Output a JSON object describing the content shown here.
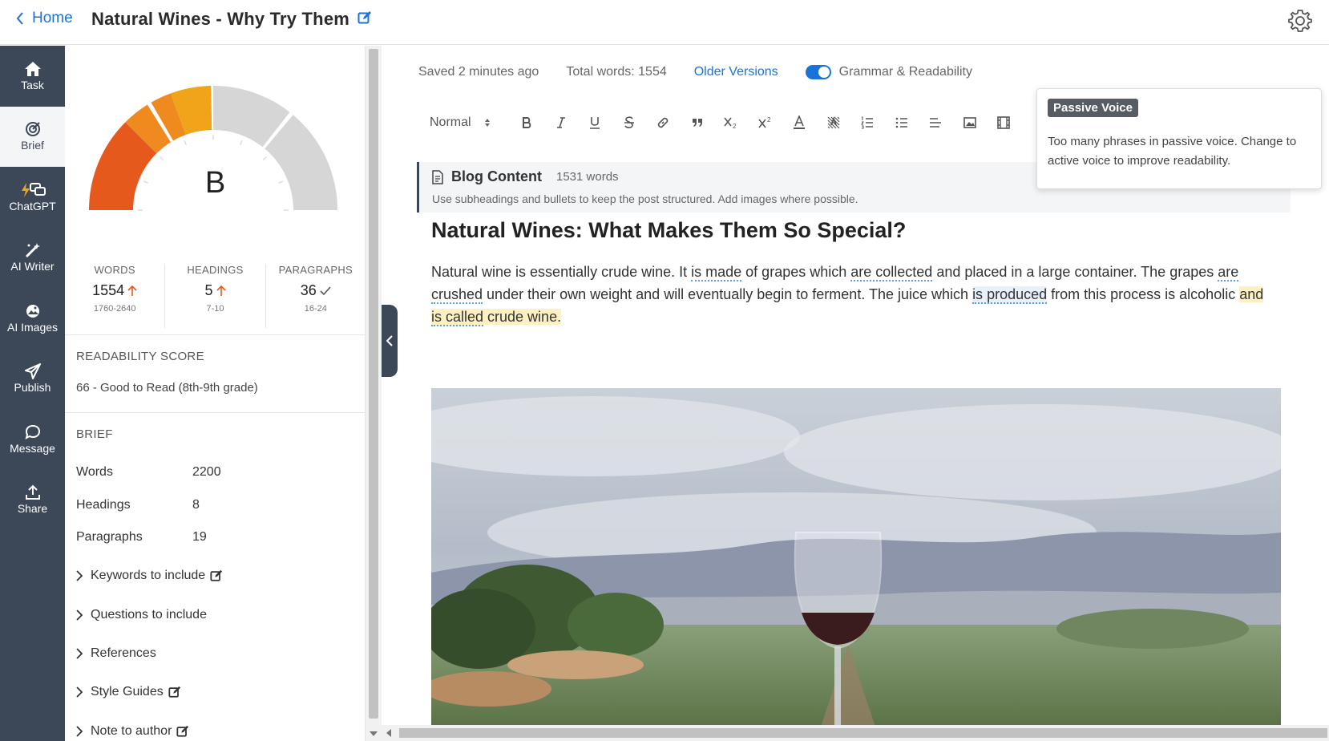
{
  "header": {
    "home_label": "Home",
    "title": "Natural Wines - Why Try Them"
  },
  "rail": {
    "items": [
      {
        "label": "Task",
        "icon": "home-icon"
      },
      {
        "label": "Brief",
        "icon": "target-icon"
      },
      {
        "label": "ChatGPT",
        "icon": "chat-bolt-icon"
      },
      {
        "label": "AI Writer",
        "icon": "magic-wand-icon"
      },
      {
        "label": "AI Images",
        "icon": "image-icon"
      },
      {
        "label": "Publish",
        "icon": "paper-plane-icon"
      },
      {
        "label": "Message",
        "icon": "chat-bubble-icon"
      },
      {
        "label": "Share",
        "icon": "upload-icon"
      }
    ],
    "active": "Brief"
  },
  "score": {
    "grade": "B",
    "gauge_level": 0.42,
    "stats": [
      {
        "label": "WORDS",
        "value": "1554",
        "range": "1760-2640",
        "trend": "up"
      },
      {
        "label": "HEADINGS",
        "value": "5",
        "range": "7-10",
        "trend": "up"
      },
      {
        "label": "PARAGRAPHS",
        "value": "36",
        "range": "16-24",
        "trend": "check"
      }
    ]
  },
  "readability": {
    "title": "READABILITY SCORE",
    "value": "66 - Good to Read (8th-9th grade)"
  },
  "brief": {
    "title": "BRIEF",
    "rows": [
      {
        "label": "Words",
        "value": "2200"
      },
      {
        "label": "Headings",
        "value": "8"
      },
      {
        "label": "Paragraphs",
        "value": "19"
      }
    ],
    "sections": [
      {
        "label": "Keywords to include",
        "editable": true
      },
      {
        "label": "Questions to include",
        "editable": false
      },
      {
        "label": "References",
        "editable": false
      },
      {
        "label": "Style Guides",
        "editable": true
      },
      {
        "label": "Note to author",
        "editable": true
      }
    ]
  },
  "editor": {
    "saved": "Saved 2 minutes ago",
    "total_words": "Total words: 1554",
    "older_versions": "Older Versions",
    "grammar_toggle": "Grammar & Readability",
    "grammar_on": true,
    "format_select": "Normal",
    "content_box": {
      "title": "Blog Content",
      "words": "1531 words",
      "hint": "Use subheadings and bullets to keep the post structured. Add images where possible."
    },
    "heading": "Natural Wines: What Makes Them So Special?",
    "paragraph": [
      {
        "t": "Natural wine is essentially crude wine. It "
      },
      {
        "t": "is made",
        "pv": true
      },
      {
        "t": " of grapes which "
      },
      {
        "t": "are collected",
        "pv": true
      },
      {
        "t": " and placed in a large container. The grapes "
      },
      {
        "t": "are crushed",
        "pv": true
      },
      {
        "t": " under their own weight and will eventually begin to ferment. The juice which "
      },
      {
        "t": "is produced",
        "pv": true,
        "box": true
      },
      {
        "t": " from this process is alcoholic "
      },
      {
        "t": "and ",
        "hl": true
      },
      {
        "t": "is called",
        "hl": true,
        "pv": true
      },
      {
        "t": " crude wine.",
        "hl": true
      }
    ]
  },
  "tooltip": {
    "badge": "Passive Voice",
    "message": "Too many phrases in passive voice. Change to active voice to improve readability."
  },
  "colors": {
    "accent": "#1a73d9",
    "rail": "#3c4858",
    "gauge_red": "#e55a1c",
    "gauge_orange": "#ef8a1f",
    "gauge_amber": "#f0a41a",
    "gauge_grey": "#d6d6d6"
  }
}
